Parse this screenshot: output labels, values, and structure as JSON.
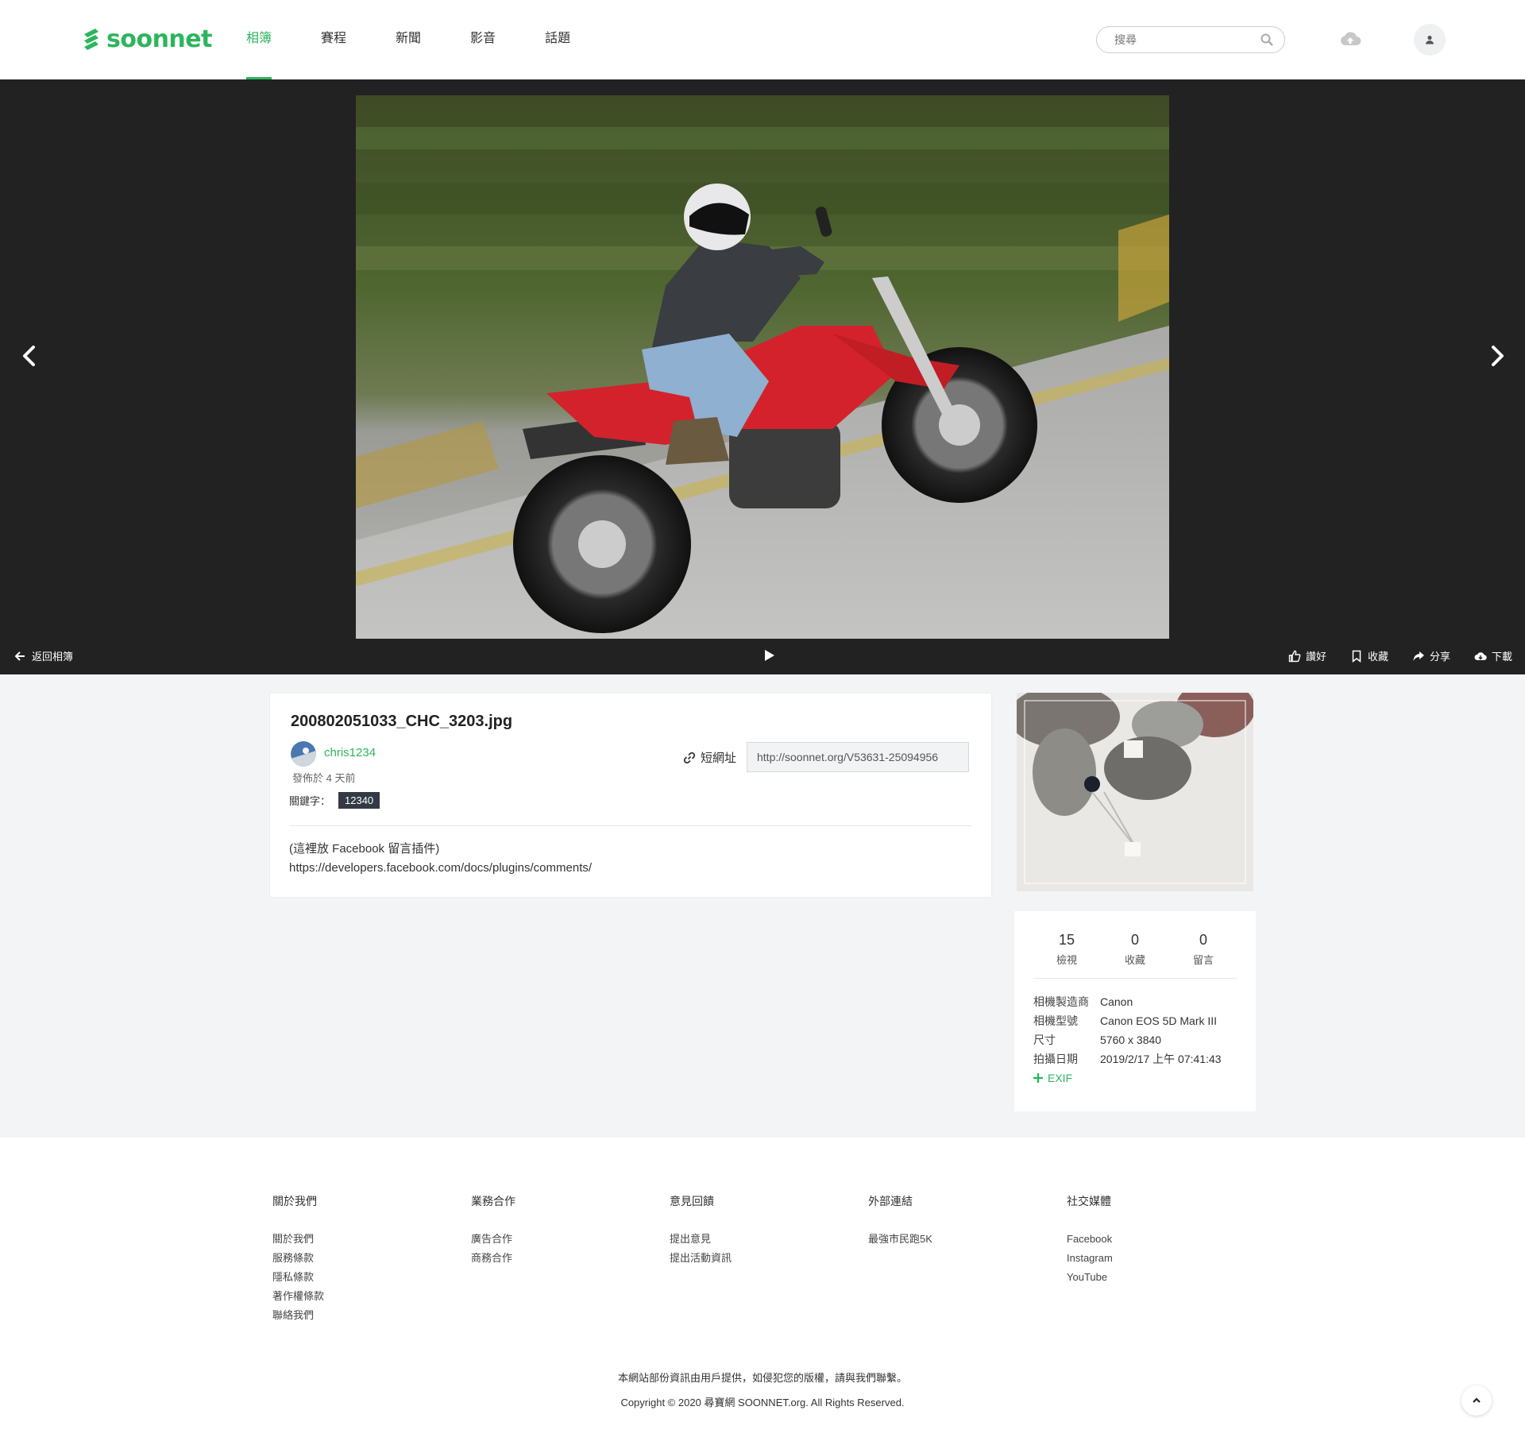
{
  "header": {
    "logo_text": "soonnet",
    "nav": [
      {
        "label": "相簿",
        "active": true
      },
      {
        "label": "賽程"
      },
      {
        "label": "新聞"
      },
      {
        "label": "影音"
      },
      {
        "label": "話題"
      }
    ],
    "search_placeholder": "搜尋"
  },
  "viewer": {
    "back_label": "返回相簿",
    "actions": {
      "like": "讚好",
      "save": "收藏",
      "share": "分享",
      "download": "下載"
    }
  },
  "photo_info": {
    "filename": "200802051033_CHC_3203.jpg",
    "username": "chris1234",
    "posted": "發佈於 4 天前",
    "keywords_label": "關鍵字：",
    "tags": [
      "12340"
    ],
    "short_url_label": "短網址",
    "short_url": "http://soonnet.org/V53631-25094956",
    "facebook_note_line1": "(這裡放 Facebook 留言插件)",
    "facebook_note_line2": "https://developers.facebook.com/docs/plugins/comments/"
  },
  "stats": {
    "views": {
      "value": "15",
      "label": "檢視"
    },
    "saves": {
      "value": "0",
      "label": "收藏"
    },
    "comments": {
      "value": "0",
      "label": "留言"
    }
  },
  "exif": {
    "rows": [
      {
        "k": "相機製造商",
        "v": "Canon"
      },
      {
        "k": "相機型號",
        "v": "Canon EOS 5D Mark III"
      },
      {
        "k": "尺寸",
        "v": "5760 x 3840"
      },
      {
        "k": "拍攝日期",
        "v": "2019/2/17 上午 07:41:43"
      }
    ],
    "more_label": "EXIF"
  },
  "footer": {
    "columns": [
      {
        "title": "關於我們",
        "links": [
          "關於我們",
          "服務條款",
          "隱私條款",
          "著作權條款",
          "聯絡我們"
        ]
      },
      {
        "title": "業務合作",
        "links": [
          "廣告合作",
          "商務合作"
        ]
      },
      {
        "title": "意見回饋",
        "links": [
          "提出意見",
          "提出活動資訊"
        ]
      },
      {
        "title": "外部連結",
        "links": [
          "最強市民跑5K"
        ]
      },
      {
        "title": "社交媒體",
        "links": [
          "Facebook",
          "Instagram",
          "YouTube"
        ]
      }
    ],
    "notice": "本網站部份資訊由用戶提供，如侵犯您的版權，請與我們聯繫。",
    "copyright": "Copyright © 2020 尋寶網 SOONNET.org. All Rights Reserved."
  },
  "colors": {
    "brand": "#2db55d",
    "viewer_bg": "#222222",
    "tag_bg": "#333a44"
  }
}
